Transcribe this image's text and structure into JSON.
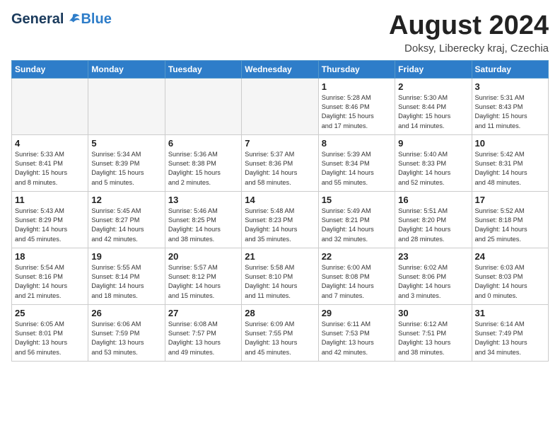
{
  "header": {
    "logo_general": "General",
    "logo_blue": "Blue",
    "title": "August 2024",
    "subtitle": "Doksy, Liberecky kraj, Czechia"
  },
  "weekdays": [
    "Sunday",
    "Monday",
    "Tuesday",
    "Wednesday",
    "Thursday",
    "Friday",
    "Saturday"
  ],
  "weeks": [
    [
      {
        "day": "",
        "info": ""
      },
      {
        "day": "",
        "info": ""
      },
      {
        "day": "",
        "info": ""
      },
      {
        "day": "",
        "info": ""
      },
      {
        "day": "1",
        "info": "Sunrise: 5:28 AM\nSunset: 8:46 PM\nDaylight: 15 hours\nand 17 minutes."
      },
      {
        "day": "2",
        "info": "Sunrise: 5:30 AM\nSunset: 8:44 PM\nDaylight: 15 hours\nand 14 minutes."
      },
      {
        "day": "3",
        "info": "Sunrise: 5:31 AM\nSunset: 8:43 PM\nDaylight: 15 hours\nand 11 minutes."
      }
    ],
    [
      {
        "day": "4",
        "info": "Sunrise: 5:33 AM\nSunset: 8:41 PM\nDaylight: 15 hours\nand 8 minutes."
      },
      {
        "day": "5",
        "info": "Sunrise: 5:34 AM\nSunset: 8:39 PM\nDaylight: 15 hours\nand 5 minutes."
      },
      {
        "day": "6",
        "info": "Sunrise: 5:36 AM\nSunset: 8:38 PM\nDaylight: 15 hours\nand 2 minutes."
      },
      {
        "day": "7",
        "info": "Sunrise: 5:37 AM\nSunset: 8:36 PM\nDaylight: 14 hours\nand 58 minutes."
      },
      {
        "day": "8",
        "info": "Sunrise: 5:39 AM\nSunset: 8:34 PM\nDaylight: 14 hours\nand 55 minutes."
      },
      {
        "day": "9",
        "info": "Sunrise: 5:40 AM\nSunset: 8:33 PM\nDaylight: 14 hours\nand 52 minutes."
      },
      {
        "day": "10",
        "info": "Sunrise: 5:42 AM\nSunset: 8:31 PM\nDaylight: 14 hours\nand 48 minutes."
      }
    ],
    [
      {
        "day": "11",
        "info": "Sunrise: 5:43 AM\nSunset: 8:29 PM\nDaylight: 14 hours\nand 45 minutes."
      },
      {
        "day": "12",
        "info": "Sunrise: 5:45 AM\nSunset: 8:27 PM\nDaylight: 14 hours\nand 42 minutes."
      },
      {
        "day": "13",
        "info": "Sunrise: 5:46 AM\nSunset: 8:25 PM\nDaylight: 14 hours\nand 38 minutes."
      },
      {
        "day": "14",
        "info": "Sunrise: 5:48 AM\nSunset: 8:23 PM\nDaylight: 14 hours\nand 35 minutes."
      },
      {
        "day": "15",
        "info": "Sunrise: 5:49 AM\nSunset: 8:21 PM\nDaylight: 14 hours\nand 32 minutes."
      },
      {
        "day": "16",
        "info": "Sunrise: 5:51 AM\nSunset: 8:20 PM\nDaylight: 14 hours\nand 28 minutes."
      },
      {
        "day": "17",
        "info": "Sunrise: 5:52 AM\nSunset: 8:18 PM\nDaylight: 14 hours\nand 25 minutes."
      }
    ],
    [
      {
        "day": "18",
        "info": "Sunrise: 5:54 AM\nSunset: 8:16 PM\nDaylight: 14 hours\nand 21 minutes."
      },
      {
        "day": "19",
        "info": "Sunrise: 5:55 AM\nSunset: 8:14 PM\nDaylight: 14 hours\nand 18 minutes."
      },
      {
        "day": "20",
        "info": "Sunrise: 5:57 AM\nSunset: 8:12 PM\nDaylight: 14 hours\nand 15 minutes."
      },
      {
        "day": "21",
        "info": "Sunrise: 5:58 AM\nSunset: 8:10 PM\nDaylight: 14 hours\nand 11 minutes."
      },
      {
        "day": "22",
        "info": "Sunrise: 6:00 AM\nSunset: 8:08 PM\nDaylight: 14 hours\nand 7 minutes."
      },
      {
        "day": "23",
        "info": "Sunrise: 6:02 AM\nSunset: 8:06 PM\nDaylight: 14 hours\nand 3 minutes."
      },
      {
        "day": "24",
        "info": "Sunrise: 6:03 AM\nSunset: 8:03 PM\nDaylight: 14 hours\nand 0 minutes."
      }
    ],
    [
      {
        "day": "25",
        "info": "Sunrise: 6:05 AM\nSunset: 8:01 PM\nDaylight: 13 hours\nand 56 minutes."
      },
      {
        "day": "26",
        "info": "Sunrise: 6:06 AM\nSunset: 7:59 PM\nDaylight: 13 hours\nand 53 minutes."
      },
      {
        "day": "27",
        "info": "Sunrise: 6:08 AM\nSunset: 7:57 PM\nDaylight: 13 hours\nand 49 minutes."
      },
      {
        "day": "28",
        "info": "Sunrise: 6:09 AM\nSunset: 7:55 PM\nDaylight: 13 hours\nand 45 minutes."
      },
      {
        "day": "29",
        "info": "Sunrise: 6:11 AM\nSunset: 7:53 PM\nDaylight: 13 hours\nand 42 minutes."
      },
      {
        "day": "30",
        "info": "Sunrise: 6:12 AM\nSunset: 7:51 PM\nDaylight: 13 hours\nand 38 minutes."
      },
      {
        "day": "31",
        "info": "Sunrise: 6:14 AM\nSunset: 7:49 PM\nDaylight: 13 hours\nand 34 minutes."
      }
    ]
  ]
}
